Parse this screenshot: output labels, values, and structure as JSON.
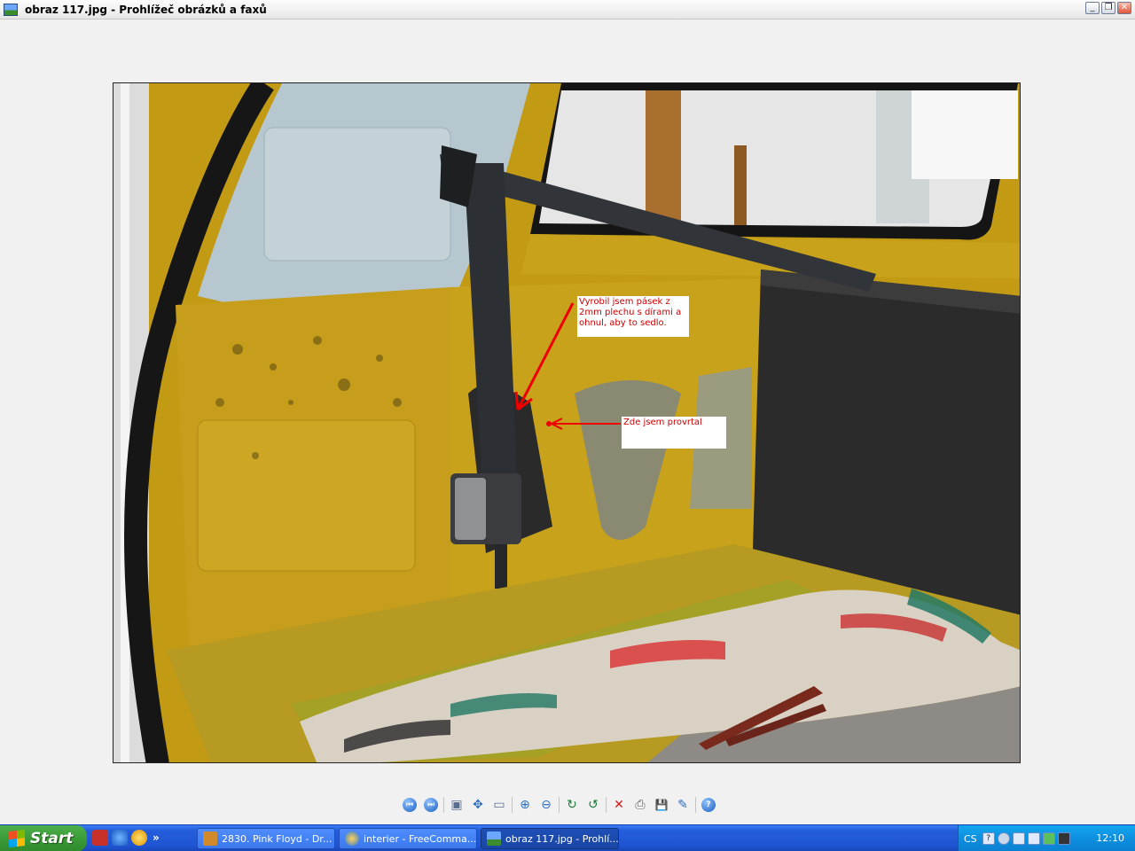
{
  "window": {
    "title": "obraz 117.jpg - Prohlížeč obrázků a faxů",
    "controls": {
      "minimize": "_",
      "restore": "❐",
      "close": "✕"
    }
  },
  "photo": {
    "annotations": [
      "Vyrobil jsem pásek z 2mm plechu s dírami a ohnul, aby to sedlo.",
      "Zde jsem provrtal"
    ],
    "colors": {
      "annotation_text": "#cc0000",
      "arrow": "#ee0000",
      "car_paint": "#c9a11a"
    }
  },
  "toolbar": {
    "buttons": [
      {
        "name": "previous-image",
        "glyph": "⏮"
      },
      {
        "name": "next-image",
        "glyph": "⏭"
      },
      {
        "name": "best-fit",
        "glyph": "▣"
      },
      {
        "name": "actual-size",
        "glyph": "✥"
      },
      {
        "name": "slideshow",
        "glyph": "▭"
      },
      {
        "name": "zoom-in",
        "glyph": "⊕"
      },
      {
        "name": "zoom-out",
        "glyph": "⊖"
      },
      {
        "name": "rotate-clockwise",
        "glyph": "↻"
      },
      {
        "name": "rotate-counterclockwise",
        "glyph": "↺"
      },
      {
        "name": "delete",
        "glyph": "✕"
      },
      {
        "name": "print",
        "glyph": "⎙"
      },
      {
        "name": "save",
        "glyph": "💾"
      },
      {
        "name": "edit",
        "glyph": "✎"
      },
      {
        "name": "help",
        "glyph": "?"
      }
    ]
  },
  "taskbar": {
    "start_label": "Start",
    "more": "»",
    "tasks": [
      {
        "label": "2830. Pink Floyd - Dr...",
        "active": false
      },
      {
        "label": "interier - FreeComma...",
        "active": false
      },
      {
        "label": "obraz 117.jpg - Prohlí...",
        "active": true
      }
    ],
    "tray": {
      "language": "CS",
      "clock": "12:10"
    }
  }
}
